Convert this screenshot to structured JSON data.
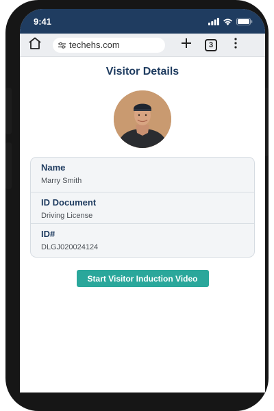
{
  "status_bar": {
    "time": "9:41"
  },
  "browser": {
    "url": "techehs.com",
    "tab_count": "3"
  },
  "page": {
    "title": "Visitor Details",
    "fields": [
      {
        "label": "Name",
        "value": "Marry Smith"
      },
      {
        "label": "ID Document",
        "value": "Driving License"
      },
      {
        "label": "ID#",
        "value": "DLGJ020024124"
      }
    ],
    "cta_label": "Start Visitor Induction Video"
  },
  "icons": [
    "signal-icon",
    "wifi-icon",
    "battery-icon",
    "home-icon",
    "tune-icon",
    "plus-icon",
    "tabs-icon",
    "more-icon"
  ],
  "colors": {
    "header": "#1f3c60",
    "accent": "#2aa79b",
    "card_bg": "#f3f5f7"
  }
}
